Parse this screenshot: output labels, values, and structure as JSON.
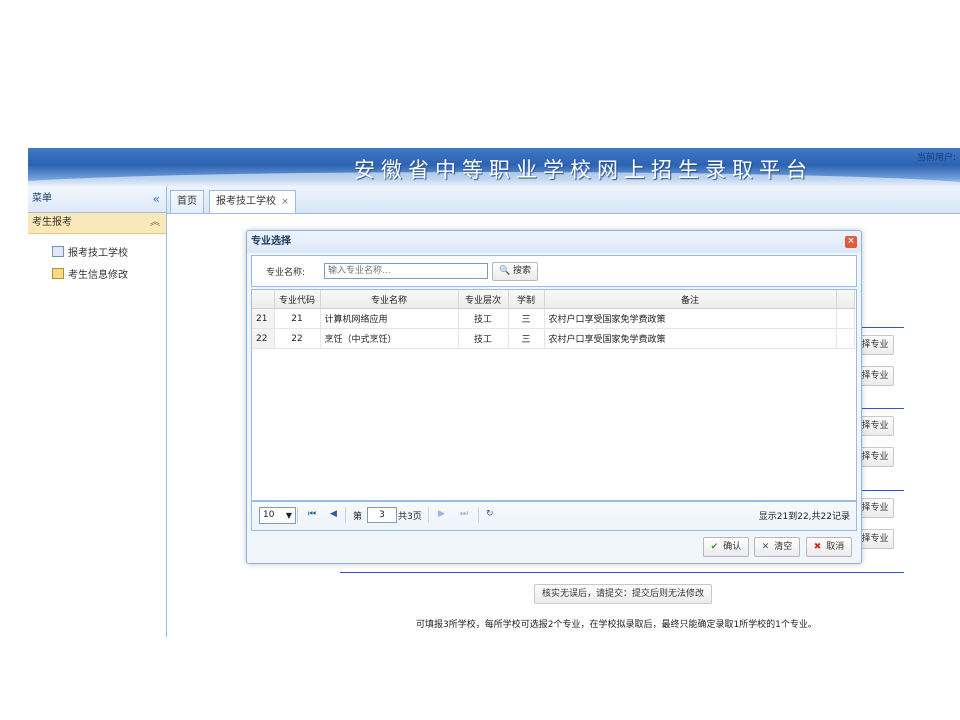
{
  "header": {
    "title": "安徽省中等职业学校网上招生录取平台",
    "user_label": "当前用户:"
  },
  "sidebar": {
    "title": "菜单",
    "collapse_icon": "double-chevron-left-icon",
    "section": "考生报考",
    "items": [
      {
        "label": "报考技工学校",
        "icon": "form-icon"
      },
      {
        "label": "考生信息修改",
        "icon": "edit-icon"
      }
    ]
  },
  "tabs": [
    {
      "label": "首页"
    },
    {
      "label": "报考技工学校",
      "close": "×"
    }
  ],
  "content": {
    "choose_buttons": [
      "择专业",
      "择专业",
      "择专业",
      "择专业",
      "择专业",
      "择专业"
    ],
    "submit_button": "核实无误后，请提交：提交后则无法修改",
    "note": "可填报3所学校，每所学校可选报2个专业，在学校拟录取后，最终只能确定录取1所学校的1个专业。"
  },
  "dialog": {
    "title": "专业选择",
    "close": "×",
    "search": {
      "label": "专业名称:",
      "placeholder": "输入专业名称...",
      "button": "搜索"
    },
    "columns": [
      "专业代码",
      "专业名称",
      "专业层次",
      "学制",
      "备注"
    ],
    "rows": [
      {
        "num": "21",
        "code": "21",
        "name": "计算机网络应用",
        "level": "技工",
        "years": "三",
        "remark": "农村户口享受国家免学费政策"
      },
      {
        "num": "22",
        "code": "22",
        "name": "烹饪（中式烹饪）",
        "level": "技工",
        "years": "三",
        "remark": "农村户口享受国家免学费政策"
      }
    ],
    "pager": {
      "page_size": "10",
      "page_prefix": "第",
      "page": "3",
      "page_total": "共3页",
      "info": "显示21到22,共22记录"
    },
    "buttons": {
      "confirm": "确认",
      "clear": "清空",
      "cancel": "取消"
    }
  }
}
